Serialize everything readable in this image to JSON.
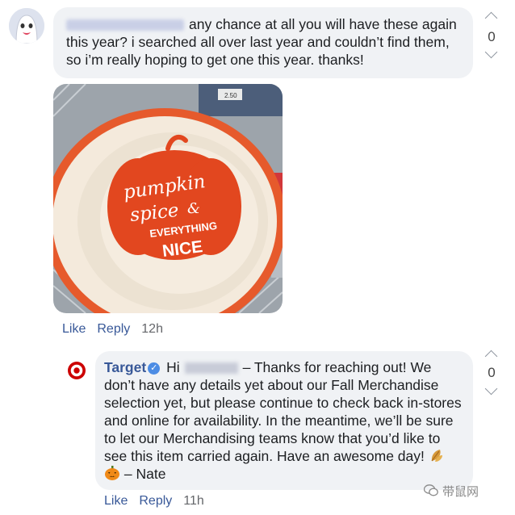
{
  "comment": {
    "text": "any chance at all you will have these again this year? i searched all over last year and couldn’t find them, so i’m really hoping to get one this year. thanks!",
    "votes": "0",
    "actions": {
      "like": "Like",
      "reply": "Reply",
      "time": "12h"
    },
    "image": {
      "plate_text_1": "pumpkin",
      "plate_text_2": "spice",
      "plate_text_3": "&",
      "plate_text_4": "EVERYTHING",
      "plate_text_5": "NICE",
      "tag_text": "2.50"
    }
  },
  "reply": {
    "author": "Target",
    "greeting": "Hi",
    "text_a": "– Thanks for reaching out! We don’t have any details yet about our Fall Merchandise selection yet, but please continue to check back in-stores and online for availability. In the meantime, we’ll be sure to let our Merchandising teams know that you’d like to see this item carried again. Have an awesome day!",
    "text_b": "– Nate",
    "votes": "0",
    "actions": {
      "like": "Like",
      "reply": "Reply",
      "time": "11h"
    }
  },
  "watermark": {
    "text": "带鼠网"
  },
  "colors": {
    "link": "#385898",
    "bubble": "#f0f2f5",
    "target_red": "#cc0000",
    "plate_orange": "#e2471f"
  }
}
